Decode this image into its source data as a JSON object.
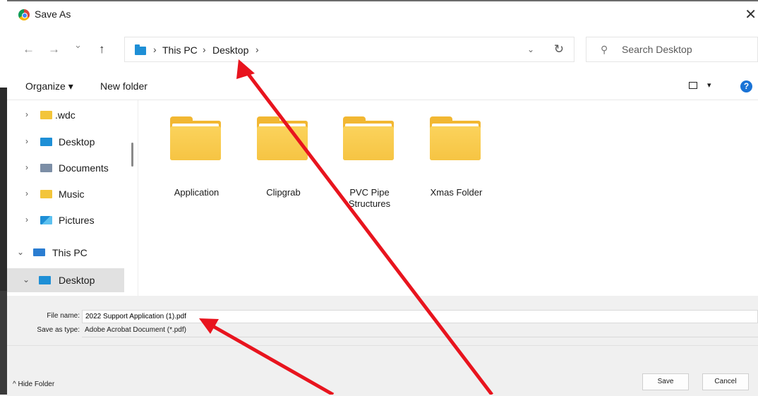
{
  "window": {
    "title": "Save As",
    "close_glyph": "✕"
  },
  "nav": {
    "back_glyph": "←",
    "forward_glyph": "→",
    "recent_glyph": "⌄",
    "up_glyph": "↑",
    "breadcrumb": [
      "This PC",
      "Desktop"
    ],
    "breadcrumb_sep": "›",
    "dropdown_glyph": "⌄",
    "refresh_glyph": "↻"
  },
  "search": {
    "placeholder": "Search Desktop",
    "icon": "search-icon"
  },
  "commands": {
    "organize": "Organize ▾",
    "new_folder": "New folder",
    "view_dropdown": "▾",
    "help": "?"
  },
  "sidebar": {
    "items": [
      {
        "label": ".wdc",
        "chevron": "›",
        "icon": "folder-yellow",
        "selected": false
      },
      {
        "label": "Desktop",
        "chevron": "›",
        "icon": "folder-blue",
        "selected": false
      },
      {
        "label": "Documents",
        "chevron": "›",
        "icon": "documents",
        "selected": false
      },
      {
        "label": "Music",
        "chevron": "›",
        "icon": "music",
        "selected": false
      },
      {
        "label": "Pictures",
        "chevron": "›",
        "icon": "pictures",
        "selected": false
      },
      {
        "label": "This PC",
        "chevron": "⌄",
        "icon": "computer",
        "selected": false
      },
      {
        "label": "Desktop",
        "chevron": "⌄",
        "icon": "folder-blue",
        "selected": true
      }
    ]
  },
  "folders": [
    {
      "name": "Application"
    },
    {
      "name": "Clipgrab"
    },
    {
      "name": "PVC Pipe Structures"
    },
    {
      "name": "Xmas Folder"
    }
  ],
  "form": {
    "file_name_label": "File name:",
    "file_name_value": "2022 Support Application (1).pdf",
    "save_type_label": "Save as type:",
    "save_type_value": "Adobe Acrobat Document (*.pdf)"
  },
  "footer": {
    "hide_folders": "^ Hide Folder",
    "save": "Save",
    "cancel": "Cancel"
  },
  "annotation": {
    "arrow_color": "#e8141e"
  }
}
